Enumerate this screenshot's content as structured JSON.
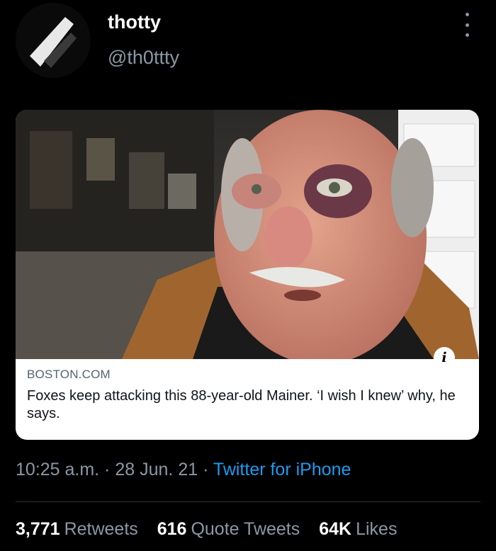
{
  "author": {
    "display_name": "thotty",
    "handle": "@th0ttty",
    "avatar_icon": "profile-avatar"
  },
  "header": {
    "more_icon": "more-vertical-icon"
  },
  "card": {
    "domain": "BOSTON.COM",
    "title": "Foxes keep attacking this 88-year-old Mainer. ‘I wish I knew’ why, he says.",
    "info_icon_glyph": "i"
  },
  "meta": {
    "time": "10:25 a.m.",
    "separator": "·",
    "date": "28 Jun. 21",
    "source": "Twitter for iPhone"
  },
  "stats": {
    "retweets_count": "3,771",
    "retweets_label": "Retweets",
    "quotes_count": "616",
    "quotes_label": "Quote Tweets",
    "likes_count": "64K",
    "likes_label": "Likes"
  },
  "colors": {
    "background": "#000000",
    "link": "#1d9bf0",
    "secondary_text": "#8b98a5"
  }
}
